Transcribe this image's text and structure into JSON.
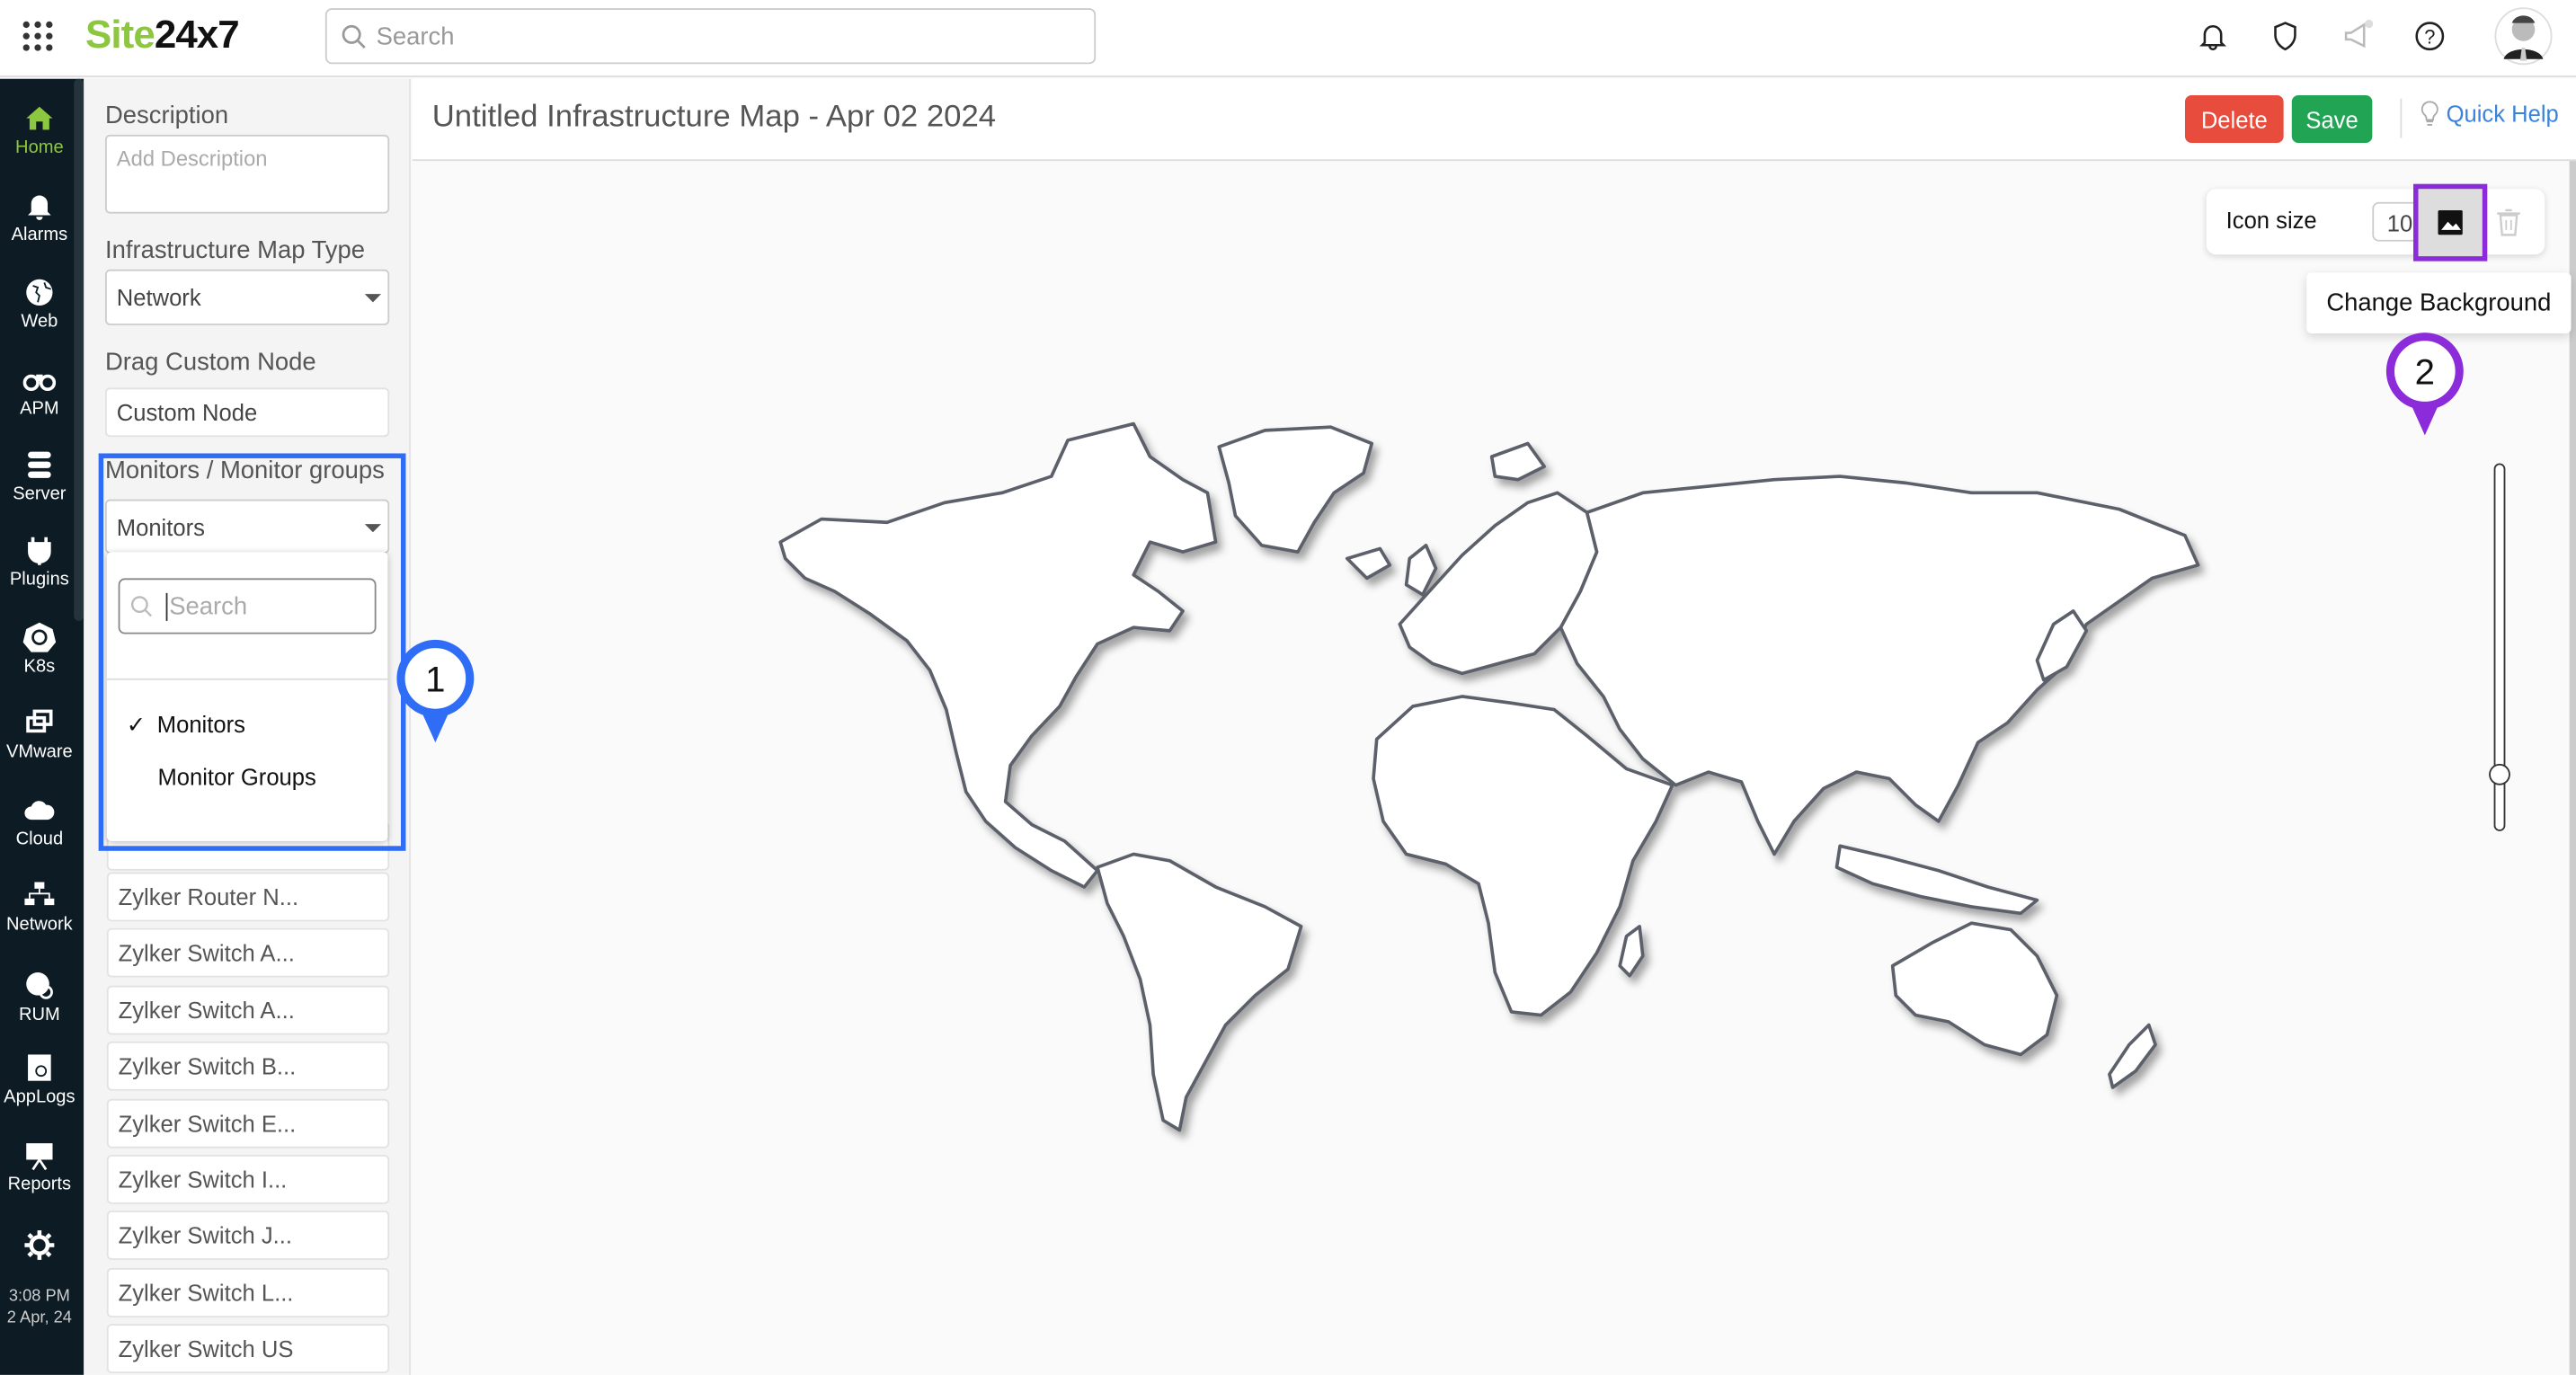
{
  "header": {
    "logo_green": "Site",
    "logo_dark": "24x7",
    "search_placeholder": "Search"
  },
  "sidebar": {
    "items": [
      {
        "label": "Home",
        "icon": "home-icon"
      },
      {
        "label": "Alarms",
        "icon": "bell-icon"
      },
      {
        "label": "Web",
        "icon": "globe-icon"
      },
      {
        "label": "APM",
        "icon": "binoculars-icon"
      },
      {
        "label": "Server",
        "icon": "server-icon"
      },
      {
        "label": "Plugins",
        "icon": "plug-icon"
      },
      {
        "label": "K8s",
        "icon": "kubernetes-icon"
      },
      {
        "label": "VMware",
        "icon": "vmware-icon"
      },
      {
        "label": "Cloud",
        "icon": "cloud-icon"
      },
      {
        "label": "Network",
        "icon": "network-icon"
      },
      {
        "label": "RUM",
        "icon": "rum-icon"
      },
      {
        "label": "AppLogs",
        "icon": "applogs-icon"
      },
      {
        "label": "Reports",
        "icon": "reports-icon"
      }
    ],
    "time": "3:08 PM",
    "date": "2 Apr, 24",
    "accent": "#8dc63f"
  },
  "panel": {
    "description_label": "Description",
    "description_placeholder": "Add Description",
    "map_type_label": "Infrastructure Map Type",
    "map_type_value": "Network",
    "custom_node_label": "Drag Custom Node",
    "custom_node": "Custom Node",
    "monitors_label": "Monitors / Monitor groups",
    "monitors_value": "Monitors",
    "dropdown": {
      "search_placeholder": "Search",
      "options": [
        {
          "label": "Monitors",
          "selected": true
        },
        {
          "label": "Monitor Groups",
          "selected": false
        }
      ]
    },
    "monitors": [
      "Zylker Router N...",
      "Zylker Switch A...",
      "Zylker Switch A...",
      "Zylker Switch B...",
      "Zylker Switch E...",
      "Zylker Switch I...",
      "Zylker Switch J...",
      "Zylker Switch L...",
      "Zylker Switch US"
    ]
  },
  "main": {
    "title": "Untitled Infrastructure Map - Apr 02 2024",
    "delete": "Delete",
    "save": "Save",
    "quick_help": "Quick Help",
    "icon_size_label": "Icon size",
    "icon_size_value": "10",
    "tooltip": "Change Background",
    "zoom_level": 0.1
  },
  "annotations": {
    "one": "1",
    "two": "2",
    "blue": "#2f6df6",
    "purple": "#8b2bd9"
  }
}
